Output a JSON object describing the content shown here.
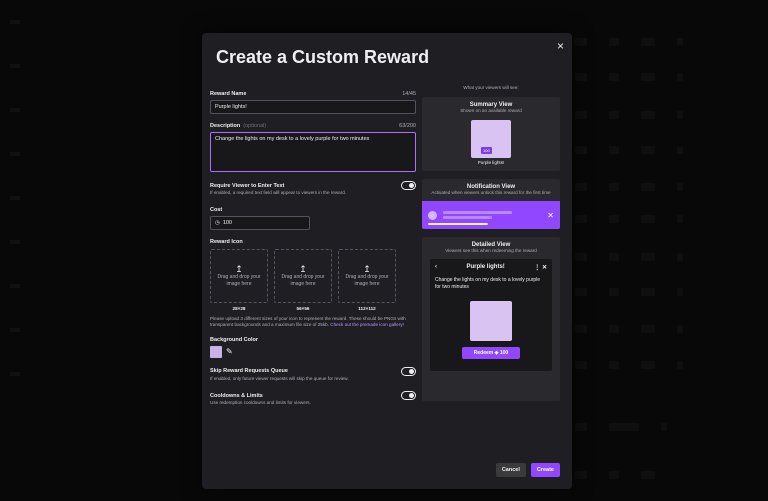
{
  "modal": {
    "title": "Create a Custom Reward",
    "close_label": "×"
  },
  "form": {
    "reward_name": {
      "label": "Reward Name",
      "count": "14/45",
      "value": "Purple lights!"
    },
    "description": {
      "label": "Description",
      "optional": "(optional)",
      "count": "63/200",
      "value": "Change the lights on my desk to a lovely purple for two minutes"
    },
    "require_text": {
      "label": "Require Viewer to Enter Text",
      "help": "If enabled, a required text field will appear to viewers in the reward."
    },
    "cost": {
      "label": "Cost",
      "value": "100"
    },
    "reward_icon": {
      "label": "Reward Icon",
      "box_text": "Drag and drop your image here",
      "sizes": [
        "28×28",
        "56×56",
        "112×112"
      ],
      "help": "Please upload 3 different sizes of your icon to represent the reward. These should be PNGs with transparent backgrounds and a maximum file size of 25kb.",
      "link": "Check out the premade icon gallery!"
    },
    "background_color": {
      "label": "Background Color",
      "value": "#c7b3e6"
    },
    "skip_queue": {
      "label": "Skip Reward Requests Queue",
      "help": "If enabled, only future viewer requests will skip the queue for review."
    },
    "cooldowns": {
      "label": "Cooldowns & Limits",
      "help": "Use redemption cooldowns and limits for viewers."
    }
  },
  "preview": {
    "heading": "What your viewers will see:",
    "summary": {
      "title": "Summary View",
      "sub": "Shown on an available reward",
      "badge": "100",
      "name": "Purple lights!"
    },
    "notification": {
      "title": "Notification View",
      "sub": "Activated when viewers unlock this reward for the first time"
    },
    "detailed": {
      "title": "Detailed View",
      "sub": "Viewers see this when redeeming the reward",
      "header": "Purple lights!",
      "desc": "Change the lights on my desk to a lovely purple for two minutes",
      "redeem": "Redeem",
      "redeem_cost": "100"
    }
  },
  "footer": {
    "cancel": "Cancel",
    "create": "Create"
  },
  "colors": {
    "accent": "#9147ff",
    "modal_bg": "#1f1f23",
    "panel_bg": "#2a2a2e"
  }
}
